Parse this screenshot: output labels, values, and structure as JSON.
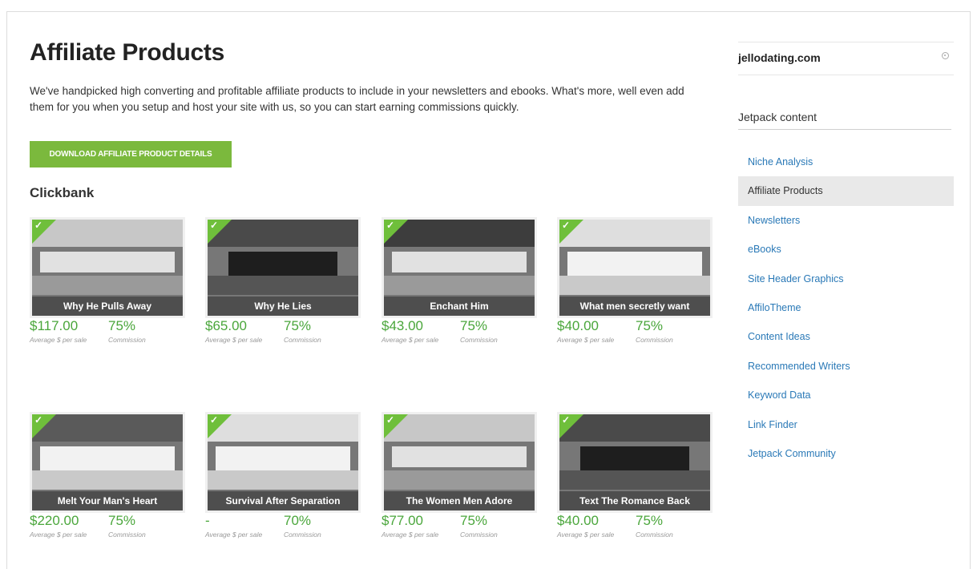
{
  "main": {
    "title": "Affiliate Products",
    "intro": "We've handpicked high converting and profitable affiliate products to include in your newsletters and ebooks. What's more, well even add them for you when you setup and host your site with us, so you can start earning commissions quickly.",
    "download_button": "DOWNLOAD AFFILIATE PRODUCT DETAILS",
    "section_title": "Clickbank",
    "price_label": "Average $ per sale",
    "commission_label": "Commission",
    "products": [
      {
        "name": "Why He Pulls Away",
        "price": "$117.00",
        "commission": "75%"
      },
      {
        "name": "Why He Lies",
        "price": "$65.00",
        "commission": "75%"
      },
      {
        "name": "Enchant Him",
        "price": "$43.00",
        "commission": "75%"
      },
      {
        "name": "What men secretly want",
        "price": "$40.00",
        "commission": "75%"
      },
      {
        "name": "Melt Your Man's Heart",
        "price": "$220.00",
        "commission": "75%"
      },
      {
        "name": "Survival After Separation",
        "price": "-",
        "commission": "70%"
      },
      {
        "name": "The Women Men Adore",
        "price": "$77.00",
        "commission": "75%"
      },
      {
        "name": "Text The Romance Back",
        "price": "$40.00",
        "commission": "75%"
      }
    ]
  },
  "sidebar": {
    "site_name": "jellodating.com",
    "heading": "Jetpack content",
    "items": [
      {
        "label": "Niche Analysis",
        "active": false
      },
      {
        "label": "Affiliate Products",
        "active": true
      },
      {
        "label": "Newsletters",
        "active": false
      },
      {
        "label": "eBooks",
        "active": false
      },
      {
        "label": "Site Header Graphics",
        "active": false
      },
      {
        "label": "AffiloTheme",
        "active": false
      },
      {
        "label": "Content Ideas",
        "active": false
      },
      {
        "label": "Recommended Writers",
        "active": false
      },
      {
        "label": "Keyword Data",
        "active": false
      },
      {
        "label": "Link Finder",
        "active": false
      },
      {
        "label": "Jetpack Community",
        "active": false
      }
    ]
  },
  "colors": {
    "accent_green": "#7bb93d",
    "price_green": "#4aa63b",
    "link_blue": "#2a79b7",
    "active_bg": "#e9e9e9"
  },
  "icons": {
    "featured": "check-icon",
    "site_settings": "gear-icon"
  }
}
